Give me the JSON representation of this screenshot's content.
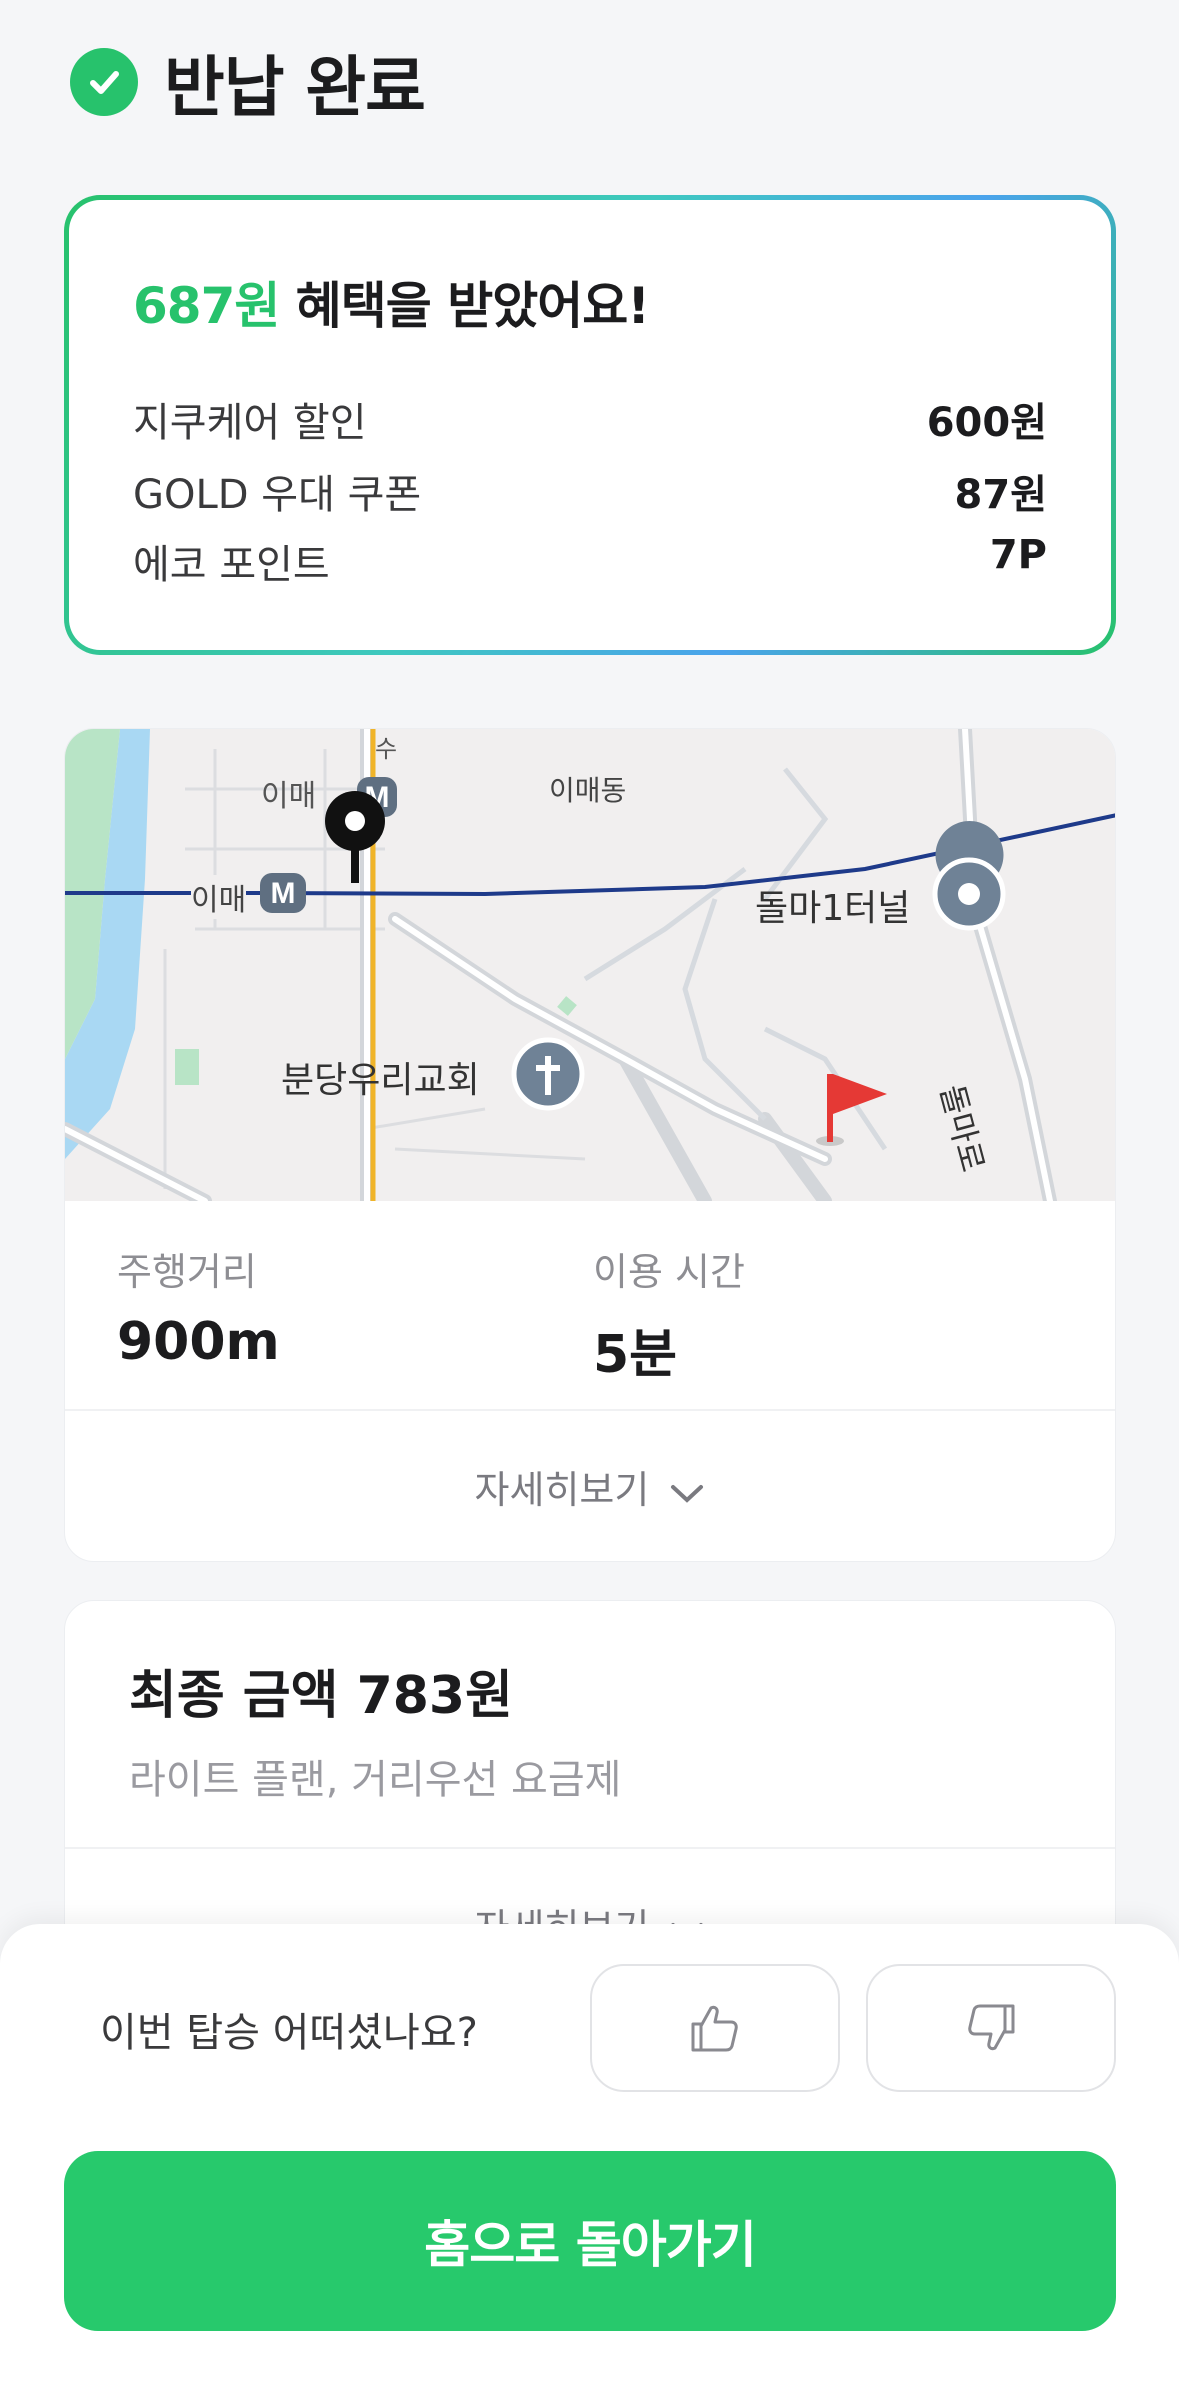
{
  "header": {
    "title": "반납 완료"
  },
  "benefit": {
    "amount": "687원",
    "title_suffix": " 혜택을 받았어요!",
    "items": [
      {
        "label": "지쿠케어 할인",
        "value": "600원"
      },
      {
        "label": "GOLD 우대 쿠폰",
        "value": "87원"
      },
      {
        "label": "에코 포인트",
        "value": "7P"
      }
    ]
  },
  "map": {
    "labels": {
      "station_top": "이매",
      "station_left": "이매",
      "neighborhood": "이매동",
      "terminal": "돌마1터널",
      "church": "분당우리교회",
      "road": "돌마로",
      "road_top": "수"
    },
    "metro_symbol": "M",
    "route_color": "#1e3a8a"
  },
  "trip": {
    "distance_label": "주행거리",
    "distance_value": "900m",
    "time_label": "이용 시간",
    "time_value": "5분",
    "more_label": "자세히보기"
  },
  "fare": {
    "title": "최종 금액 783원",
    "subtitle": "라이트 플랜, 거리우선 요금제",
    "more_label": "자세히보기"
  },
  "rating": {
    "question": "이번 탑승 어떠셨나요?",
    "like_icon": "thumbs-up-icon",
    "dislike_icon": "thumbs-down-icon"
  },
  "home_button": {
    "label": "홈으로 돌아가기"
  },
  "colors": {
    "accent": "#27c96c",
    "route": "#1e3a8a",
    "flag": "#e53935"
  }
}
